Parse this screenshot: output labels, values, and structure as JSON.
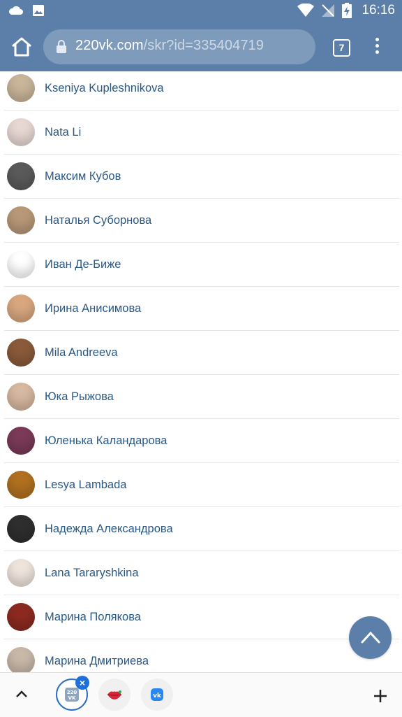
{
  "status_bar": {
    "time": "16:16",
    "left_icons": [
      "cloud-icon",
      "image-icon"
    ],
    "right_icons": [
      "wifi-icon",
      "no-signal-icon",
      "battery-charging-icon"
    ]
  },
  "toolbar": {
    "url_domain": "220vk.com",
    "url_path": "/skr?id=335404719",
    "tab_count": "7"
  },
  "friends": [
    {
      "name": "Kseniya Kupleshnikova",
      "avatar_color": "#c9b59a"
    },
    {
      "name": "Nata Li",
      "avatar_color": "#e8d8d4"
    },
    {
      "name": "Максим Кубов",
      "avatar_color": "#5a5a5a"
    },
    {
      "name": "Наталья Суборнова",
      "avatar_color": "#b89878"
    },
    {
      "name": "Иван Де-Биже",
      "avatar_color": "#ffffff"
    },
    {
      "name": "Ирина Анисимова",
      "avatar_color": "#d9a77f"
    },
    {
      "name": "Mila Andreeva",
      "avatar_color": "#8a5a3a"
    },
    {
      "name": "Юка Рыжова",
      "avatar_color": "#d7b8a0"
    },
    {
      "name": "Юленька Каландарова",
      "avatar_color": "#7a3a58"
    },
    {
      "name": "Lesya Lambada",
      "avatar_color": "#b07020"
    },
    {
      "name": "Надежда Александрова",
      "avatar_color": "#2e2e2e"
    },
    {
      "name": "Lana Tararyshkina",
      "avatar_color": "#eee4dc"
    },
    {
      "name": "Марина Полякова",
      "avatar_color": "#8c2a20"
    },
    {
      "name": "Марина Дмитриева",
      "avatar_color": "#c8b8a8"
    }
  ],
  "bottom_bar": {
    "tab1_label": "220\nVK",
    "close_label": "×"
  },
  "colors": {
    "header": "#5b7fa9",
    "link": "#2a5885",
    "accent_blue": "#1e6fd9"
  }
}
